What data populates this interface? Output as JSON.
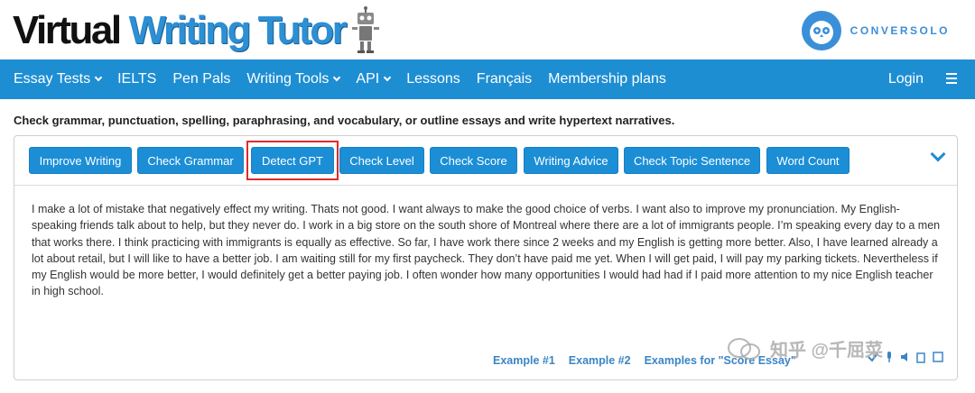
{
  "header": {
    "logo_word1": "Virtual",
    "logo_word2": "Writing Tutor",
    "partner_name": "CONVERSOLO"
  },
  "nav": {
    "items": [
      {
        "label": "Essay Tests",
        "dropdown": true
      },
      {
        "label": "IELTS",
        "dropdown": false
      },
      {
        "label": "Pen Pals",
        "dropdown": false
      },
      {
        "label": "Writing Tools",
        "dropdown": true
      },
      {
        "label": "API",
        "dropdown": true
      },
      {
        "label": "Lessons",
        "dropdown": false
      },
      {
        "label": "Français",
        "dropdown": false
      },
      {
        "label": "Membership plans",
        "dropdown": false
      }
    ],
    "login_label": "Login",
    "menu_icon": "hamburger-icon"
  },
  "tagline": "Check grammar, punctuation, spelling, paraphrasing, and vocabulary, or outline essays and write hypertext narratives.",
  "toolbar": {
    "buttons": [
      {
        "label": "Improve Writing"
      },
      {
        "label": "Check Grammar"
      },
      {
        "label": "Detect GPT",
        "highlighted": true
      },
      {
        "label": "Check Level"
      },
      {
        "label": "Check Score"
      },
      {
        "label": "Writing Advice"
      },
      {
        "label": "Check Topic Sentence"
      },
      {
        "label": "Word Count"
      }
    ],
    "collapse_icon": "chevron-down-icon"
  },
  "essay_text": "I make a lot of mistake that negatively effect my writing. Thats not good. I want always to make the good choice of verbs. I want also to improve my pronunciation. My English-speaking friends talk about to help, but they never do. I work in a big store on the south shore of Montreal where there are a lot of immigrants people. I’m speaking every day to a men that works there. I think practicing with immigrants is equally as effective. So far, I have work there since 2 weeks and my English is getting more better. Also, I have learned already a lot about retail, but I will like to have a better job. I am waiting still for my first paycheck. They don’t have paid me yet. When I will get paid, I will pay my parking tickets. Nevertheless if my English would be more better, I would definitely get a better paying job. I often wonder how many opportunities I would had had if I paid more attention to my nice English teacher in high school.",
  "examples": {
    "ex1": "Example #1",
    "ex2": "Example #2",
    "ex3": "Examples for \"Score Essay\""
  },
  "watermark": "知乎 @千屈菜",
  "colors": {
    "primary_blue": "#1e8ed3",
    "highlight_red": "#e02a2a",
    "link_blue": "#3a85c5"
  }
}
